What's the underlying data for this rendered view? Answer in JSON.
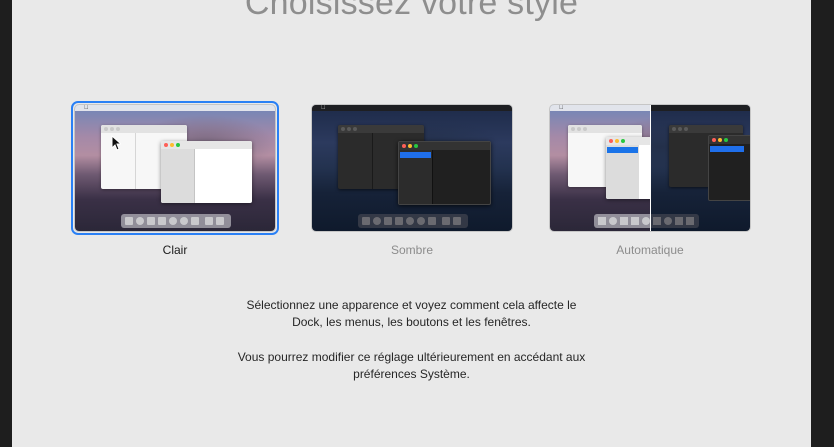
{
  "title": "Choisissez votre style",
  "choices": [
    {
      "label": "Clair",
      "selected": true
    },
    {
      "label": "Sombre",
      "selected": false
    },
    {
      "label": "Automatique",
      "selected": false
    }
  ],
  "description": {
    "line1": "Sélectionnez une apparence et voyez comment cela affecte le",
    "line2": "Dock, les menus, les boutons et les fenêtres.",
    "line3": "Vous pourrez modifier ce réglage ultérieurement en accédant aux",
    "line4": "préférences Système."
  },
  "colors": {
    "accent": "#2a80f5",
    "panel_bg": "#e9e9e9",
    "title": "#8e8e8e",
    "unselected_label": "#8c8c8c"
  },
  "icons": {
    "apple": "apple-logo-icon",
    "cursor": "mouse-pointer-icon"
  }
}
